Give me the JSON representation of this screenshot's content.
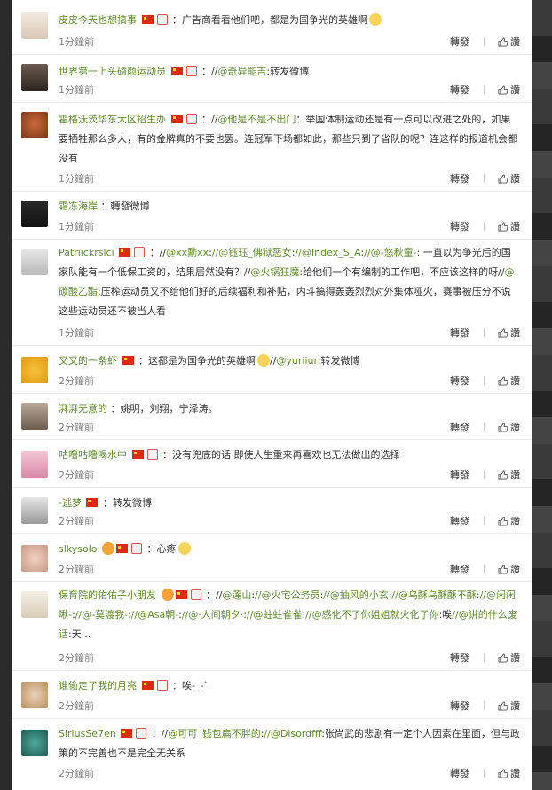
{
  "labels": {
    "repost": "轉發",
    "like": "讚"
  },
  "comments": [
    {
      "user": "皮皮今天也想搞事",
      "text": "：广告商看看他们吧，都是为国争光的英雄啊",
      "time": "1分鐘前"
    },
    {
      "user": "世界第一上头磕颜运动员",
      "text": "：//",
      "m1": "@奇异能吉",
      "t2": ":转发微博",
      "time": "1分鐘前"
    },
    {
      "user": "霍格沃茨华东大区招生办",
      "text": "：//",
      "m1": "@他是不是不出门",
      "t2": "：举国体制运动还是有一点可以改进之处的，如果要牺牲那么多人，有的金牌真的不要也罢。连冠军下场都如此，那些只到了省队的呢？连这样的报道机会都没有",
      "time": "1分鐘前"
    },
    {
      "user": "霜冻海岸",
      "text": "：轉發微博",
      "time": "1分鐘前"
    },
    {
      "user": "Patriickrslci",
      "text": "：//",
      "m1": "@xx勳xx",
      "t2": ":",
      "m2": "//@钰珏_佛狱恶女",
      "t3": ":",
      "m3": "//@Index_S_A",
      "t4": ":",
      "m4": "//@-悠秋童-",
      "t5": ": 一直以为争光后的国家队能有一个低保工资的，结果居然没有？//",
      "m5": "@火锅狂魔",
      "t6": ":给他们一个有编制的工作吧，不应该这样的呀//",
      "m6": "@碳酸乙酯",
      "t7": ":压榨运动员又不给他们好的后续福利和补贴，内斗搞得轰轰烈烈对外集体哑火，赛事被压分不说这些运动员还不被当人看",
      "time": "1分鐘前"
    },
    {
      "user": "叉叉的一条虾",
      "text": "：这都是为国争光的英雄啊",
      "t2": "//",
      "m1": "@yuriiur",
      "t3": ":转发微博",
      "time": "2分鐘前"
    },
    {
      "user": "湃湃无意的",
      "text": "：姚明，刘翔，宁泽涛。",
      "time": "2分鐘前"
    },
    {
      "user": "咕噜咕噜喝水中",
      "text": "：没有兜底的话 即使人生重来再喜欢也无法做出的选择",
      "time": "2分鐘前"
    },
    {
      "user": "-逃梦",
      "text": "：转发微博",
      "time": "2分鐘前"
    },
    {
      "user": "slkysolo",
      "text": "：心疼",
      "time": "2分鐘前"
    },
    {
      "user": "保育院的佑佑子小朋友",
      "text": "：//",
      "m1": "@莲山",
      "t2": ":",
      "m2": "//@火宅公务员",
      "t3": ":",
      "m3": "//@抽风的小玄",
      "t4": ":",
      "m4": "//@乌酥乌酥酥不酥",
      "t5": ":",
      "m5": "//@闲闲啾-",
      "t6": ":",
      "m6": "//@-莫渡我-",
      "t7": ":",
      "m7": "//@Asa朝-",
      "t8": ":",
      "m8": "//@·人间朝夕·",
      "t9": ":",
      "m9": "//@蛀蛀雀雀",
      "t10": ":",
      "m10": "//@感化不了你姐姐就火化了你",
      "t11": ":唉",
      "m11": "//@讲的什么废话",
      "t12": ":天...",
      "time": "2分鐘前"
    },
    {
      "user": "谁偷走了我的月亮",
      "text": "：唉-_-`",
      "time": "2分鐘前"
    },
    {
      "user": "SiriusSe7en",
      "text": "：//",
      "m1": "@可可_钱包扁不胖的",
      "t2": ":",
      "m2": "//@Disordfff",
      "t3": ":张尚武的悲剧有一定个人因素在里面，但与政策的不完善也不是完全无关系",
      "time": "2分鐘前"
    }
  ]
}
